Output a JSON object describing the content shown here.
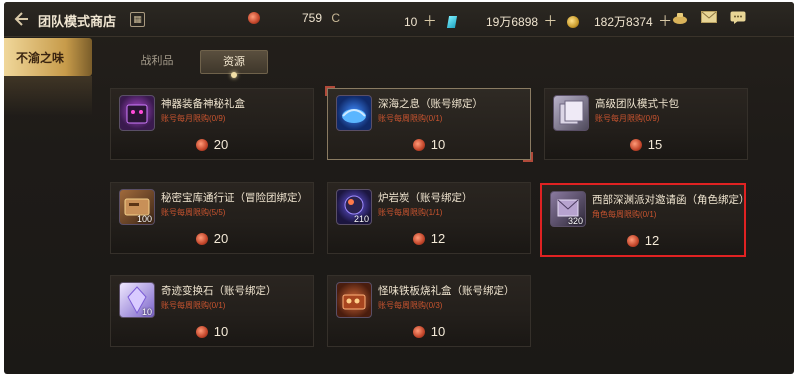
{
  "header": {
    "title": "团队模式商店",
    "currency_1": "759",
    "currency_1_mark": "C",
    "currency_2": "10",
    "currency_3": "19万6898",
    "currency_4": "182万8374"
  },
  "side_tab": {
    "label": "不渝之味"
  },
  "sub_tabs": [
    {
      "label": "战利品",
      "active": false
    },
    {
      "label": "资源",
      "active": true
    }
  ],
  "items": [
    {
      "name": "神器装备神秘礼盒",
      "limit": "账号每月限购(0/9)",
      "price": "20",
      "count": "",
      "icon": "mystery-box-icon"
    },
    {
      "name": "深海之息（账号绑定）",
      "limit": "账号每周限购(0/1)",
      "price": "10",
      "count": "",
      "icon": "deep-sea-icon"
    },
    {
      "name": "高级团队模式卡包",
      "limit": "账号每月限购(0/9)",
      "price": "15",
      "count": "",
      "icon": "card-pack-icon"
    },
    {
      "name": "秘密宝库通行证（冒险团绑定）",
      "limit": "账号每周限购(5/5)",
      "price": "20",
      "count": "100",
      "icon": "pass-icon"
    },
    {
      "name": "炉岩炭（账号绑定）",
      "limit": "账号每周限购(1/1)",
      "price": "12",
      "count": "210",
      "icon": "coal-icon"
    },
    {
      "name": "西部深渊派对邀请函（角色绑定）",
      "limit": "角色每周限购(0/1)",
      "price": "12",
      "count": "320",
      "icon": "invitation-icon"
    },
    {
      "name": "奇迹变换石（账号绑定）",
      "limit": "账号每周限购(0/1)",
      "price": "10",
      "count": "10",
      "icon": "crystal-icon"
    },
    {
      "name": "怪味铁板烧礼盒（账号绑定）",
      "limit": "账号每周限购(0/3)",
      "price": "10",
      "count": "",
      "icon": "teppanyaki-box-icon"
    }
  ],
  "colors": {
    "selection_border": "#e02222",
    "limit_text": "#c9542f",
    "accent_gold": "#c79b4a"
  }
}
